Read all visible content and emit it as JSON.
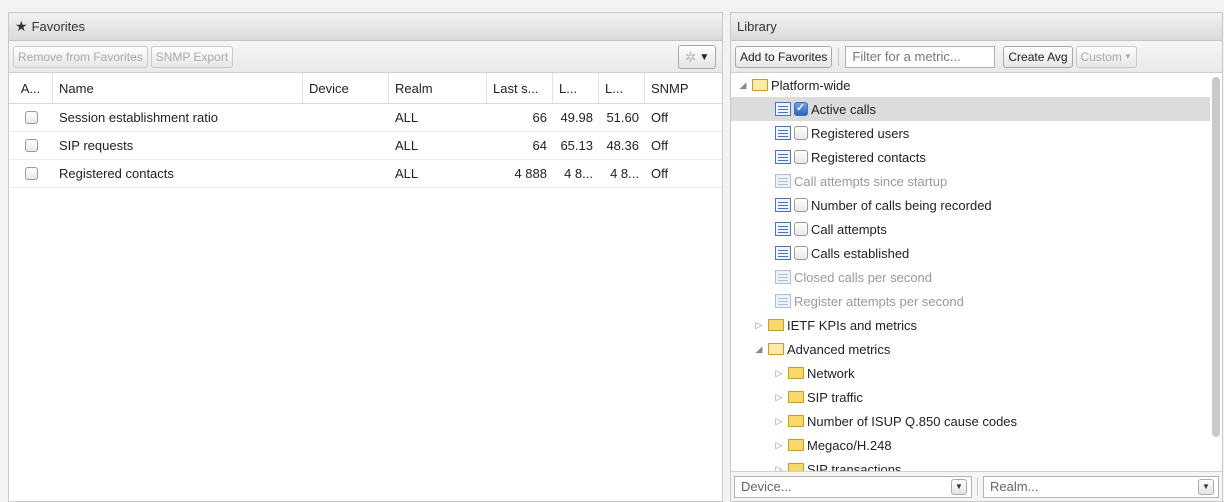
{
  "favorites": {
    "title": "Favorites",
    "toolbar": {
      "remove_label": "Remove from Favorites",
      "snmp_export_label": "SNMP Export"
    },
    "columns": [
      "A...",
      "Name",
      "Device",
      "Realm",
      "Last s...",
      "L...",
      "L...",
      "SNMP"
    ],
    "rows": [
      {
        "name": "Session establishment ratio",
        "device": "",
        "realm": "ALL",
        "last": "66",
        "l1": "49.98",
        "l2": "51.60",
        "snmp": "Off"
      },
      {
        "name": "SIP requests",
        "device": "",
        "realm": "ALL",
        "last": "64",
        "l1": "65.13",
        "l2": "48.36",
        "snmp": "Off"
      },
      {
        "name": "Registered contacts",
        "device": "",
        "realm": "ALL",
        "last": "4 888",
        "l1": "4 8...",
        "l2": "4 8...",
        "snmp": "Off"
      }
    ]
  },
  "library": {
    "title": "Library",
    "toolbar": {
      "add_label": "Add to Favorites",
      "filter_placeholder": "Filter for a metric...",
      "create_avg_label": "Create Avg",
      "custom_label": "Custom"
    },
    "tree": [
      {
        "label": "Platform-wide",
        "kind": "folder-open",
        "indent": 0
      },
      {
        "label": "Active calls",
        "kind": "metric",
        "indent": 2,
        "checked": true,
        "selected": true
      },
      {
        "label": "Registered users",
        "kind": "metric",
        "indent": 2,
        "checked": false
      },
      {
        "label": "Registered contacts",
        "kind": "metric",
        "indent": 2,
        "checked": false
      },
      {
        "label": "Call attempts since startup",
        "kind": "metric-dim",
        "indent": 2
      },
      {
        "label": "Number of calls being recorded",
        "kind": "metric",
        "indent": 2,
        "checked": false
      },
      {
        "label": "Call attempts",
        "kind": "metric",
        "indent": 2,
        "checked": false
      },
      {
        "label": "Calls established",
        "kind": "metric",
        "indent": 2,
        "checked": false
      },
      {
        "label": "Closed calls per second",
        "kind": "metric-dim",
        "indent": 2
      },
      {
        "label": "Register attempts per second",
        "kind": "metric-dim",
        "indent": 2
      },
      {
        "label": "IETF KPIs and metrics",
        "kind": "folder",
        "indent": 1
      },
      {
        "label": "Advanced metrics",
        "kind": "folder-open",
        "indent": 1
      },
      {
        "label": "Network",
        "kind": "folder",
        "indent": 2
      },
      {
        "label": "SIP traffic",
        "kind": "folder",
        "indent": 2
      },
      {
        "label": "Number of ISUP Q.850 cause codes",
        "kind": "folder",
        "indent": 2
      },
      {
        "label": "Megaco/H.248",
        "kind": "folder",
        "indent": 2
      },
      {
        "label": "SIP transactions",
        "kind": "folder",
        "indent": 2
      }
    ],
    "device_placeholder": "Device...",
    "realm_placeholder": "Realm..."
  }
}
